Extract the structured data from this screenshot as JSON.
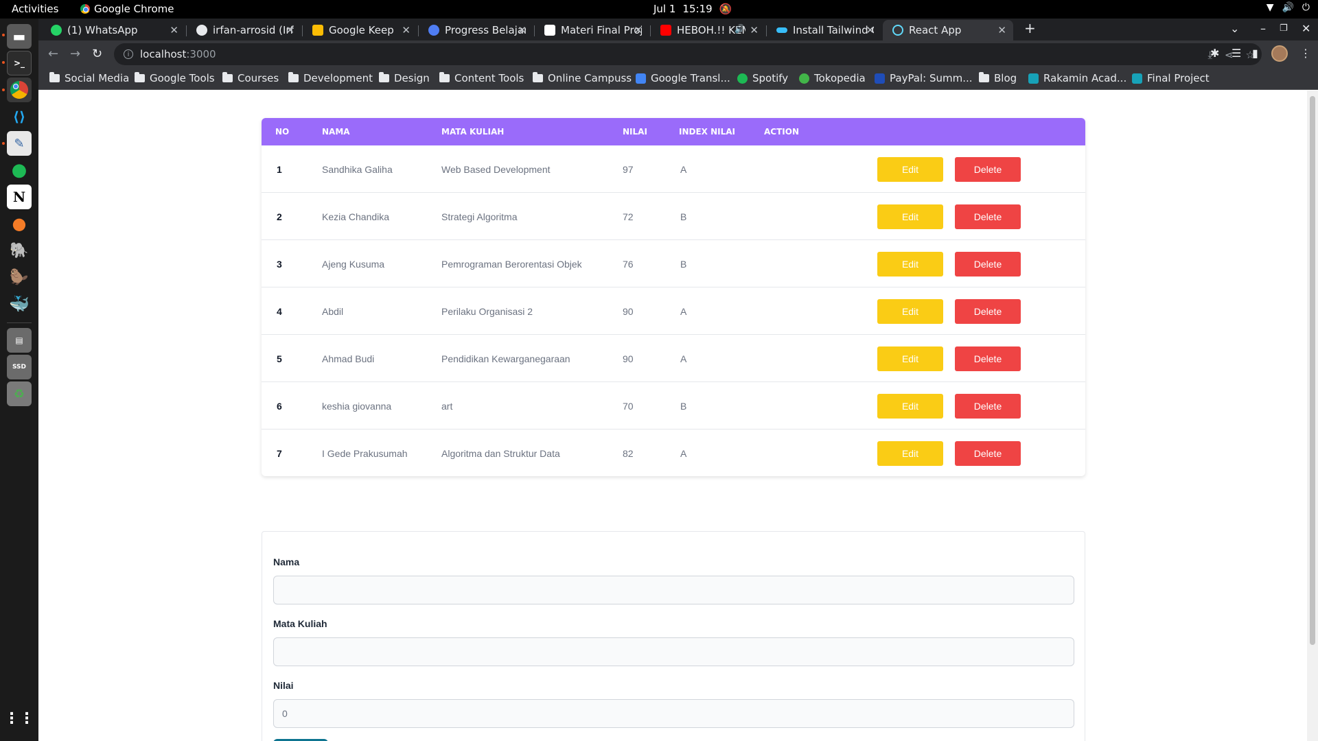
{
  "topbar": {
    "activities": "Activities",
    "app_name": "Google Chrome",
    "clock_date": "Jul 1",
    "clock_time": "15:19"
  },
  "tabs": [
    {
      "title": "(1) WhatsApp",
      "icon": "whatsapp-icon",
      "color": "#25d366"
    },
    {
      "title": "irfan-arrosid (Irfan A",
      "icon": "github-icon",
      "color": "#e8eaed"
    },
    {
      "title": "Google Keep",
      "icon": "keep-icon",
      "color": "#fbbc04"
    },
    {
      "title": "Progress Belajar | Bu",
      "icon": "progress-icon",
      "color": "#4f7df3"
    },
    {
      "title": "Materi Final Project",
      "icon": "doc-icon",
      "color": "#ffffff"
    },
    {
      "title": "HEBOH.!! KEMUN",
      "icon": "youtube-icon",
      "color": "#ff0000"
    },
    {
      "title": "Install Tailwind CSS v",
      "icon": "tailwind-icon",
      "color": "#38bdf8"
    },
    {
      "title": "React App",
      "icon": "react-icon",
      "color": "#61dafb"
    }
  ],
  "address": {
    "host": "localhost",
    "port": ":3000"
  },
  "bookmarks": [
    {
      "label": "Social Media",
      "type": "folder"
    },
    {
      "label": "Google Tools",
      "type": "folder"
    },
    {
      "label": "Courses",
      "type": "folder"
    },
    {
      "label": "Development",
      "type": "folder"
    },
    {
      "label": "Design",
      "type": "folder"
    },
    {
      "label": "Content Tools",
      "type": "folder"
    },
    {
      "label": "Online Campuss",
      "type": "folder"
    },
    {
      "label": "Google Transl...",
      "type": "link"
    },
    {
      "label": "Spotify",
      "type": "link"
    },
    {
      "label": "Tokopedia",
      "type": "link"
    },
    {
      "label": "PayPal: Summ...",
      "type": "link"
    },
    {
      "label": "Blog",
      "type": "folder"
    },
    {
      "label": "Rakamin Acad...",
      "type": "link"
    },
    {
      "label": "Final Project",
      "type": "link"
    }
  ],
  "table": {
    "headers": [
      "NO",
      "NAMA",
      "MATA KULIAH",
      "NILAI",
      "INDEX NILAI",
      "ACTION"
    ],
    "rows": [
      {
        "no": "1",
        "nama": "Sandhika Galiha",
        "matkul": "Web Based Development",
        "nilai": "97",
        "index": "A"
      },
      {
        "no": "2",
        "nama": "Kezia Chandika",
        "matkul": "Strategi Algoritma",
        "nilai": "72",
        "index": "B"
      },
      {
        "no": "3",
        "nama": "Ajeng Kusuma",
        "matkul": "Pemrograman Berorentasi Objek",
        "nilai": "76",
        "index": "B"
      },
      {
        "no": "4",
        "nama": "Abdil",
        "matkul": "Perilaku Organisasi 2",
        "nilai": "90",
        "index": "A"
      },
      {
        "no": "5",
        "nama": "Ahmad Budi",
        "matkul": "Pendidikan Kewarganegaraan",
        "nilai": "90",
        "index": "A"
      },
      {
        "no": "6",
        "nama": "keshia giovanna",
        "matkul": "art",
        "nilai": "70",
        "index": "B"
      },
      {
        "no": "7",
        "nama": "I Gede Prakusumah",
        "matkul": "Algoritma dan Struktur Data",
        "nilai": "82",
        "index": "A"
      }
    ],
    "edit_label": "Edit",
    "delete_label": "Delete"
  },
  "form": {
    "nama_label": "Nama",
    "nama_value": "",
    "matkul_label": "Mata Kuliah",
    "matkul_value": "",
    "nilai_label": "Nilai",
    "nilai_value": "0"
  },
  "colors": {
    "header_purple": "#9a6bfa",
    "edit_yellow": "#facc15",
    "delete_red": "#ef4444"
  }
}
